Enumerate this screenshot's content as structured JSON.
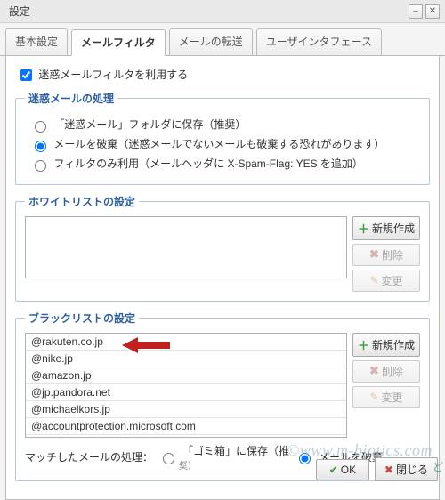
{
  "window": {
    "title": "設定"
  },
  "tabs": {
    "items": [
      "基本設定",
      "メールフィルタ",
      "メールの転送",
      "ユーザインタフェース"
    ],
    "active_index": 1
  },
  "use_spam_filter": {
    "label": "迷惑メールフィルタを利用する",
    "checked": true
  },
  "spam_handling": {
    "legend": "迷惑メールの処理",
    "options": [
      "「迷惑メール」フォルダに保存（推奨）",
      "メールを破棄（迷惑メールでないメールも破棄する恐れがあります）",
      "フィルタのみ利用（メールヘッダに X-Spam-Flag: YES を追加）"
    ],
    "selected_index": 1
  },
  "whitelist": {
    "legend": "ホワイトリストの設定",
    "items": [],
    "buttons": {
      "new": "新規作成",
      "delete": "削除",
      "edit": "変更"
    }
  },
  "blacklist": {
    "legend": "ブラックリストの設定",
    "items": [
      "@rakuten.co.jp",
      "@nike.jp",
      "@amazon.jp",
      "@jp.pandora.net",
      "@michaelkors.jp",
      "@accountprotection.microsoft.com"
    ],
    "buttons": {
      "new": "新規作成",
      "delete": "削除",
      "edit": "変更"
    },
    "match_label": "マッチしたメールの処理：",
    "match_options": [
      "「ゴミ箱」に保存（推",
      "メールを破棄"
    ],
    "match_note": "奨）",
    "match_selected_index": 1
  },
  "footer": {
    "ok": "OK",
    "close": "閉じる"
  },
  "watermark": "©www.m-biotics.com",
  "clip": "ど"
}
